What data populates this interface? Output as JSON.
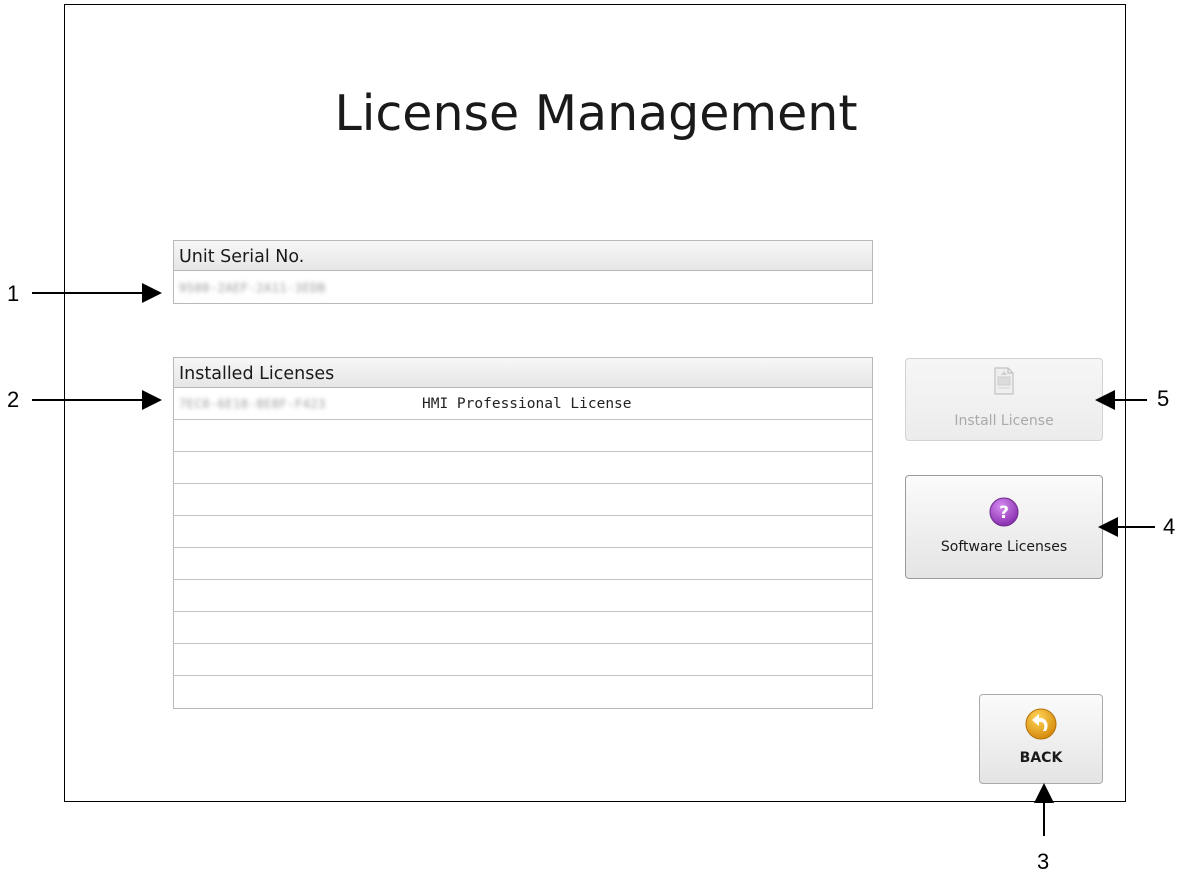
{
  "title": "License Management",
  "serial_panel": {
    "header": "Unit Serial No.",
    "value": "9500-2AEF-2A11-3EDB"
  },
  "licenses_panel": {
    "header": "Installed Licenses",
    "rows": [
      {
        "id": "7EC0-6E18-8E8F-F423",
        "name": "HMI Professional License"
      }
    ],
    "empty_rows": 9
  },
  "buttons": {
    "install_label": "Install License",
    "software_label": "Software Licenses",
    "back_label": "BACK"
  },
  "callouts": [
    "1",
    "2",
    "3",
    "4",
    "5"
  ],
  "colors": {
    "help_icon": "#9c3fc0",
    "back_icon": "#e8a317",
    "disabled_text": "#a9a9a9"
  }
}
